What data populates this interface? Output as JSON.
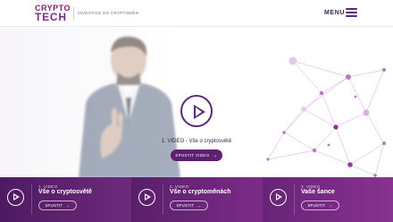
{
  "header": {
    "logo_top": "CRYPTO",
    "logo_bottom": "TECH",
    "tagline": "INVESTICE DO CRYPTOMĚN",
    "menu_label": "MENU",
    "menu_icon": "hamburger-icon"
  },
  "hero": {
    "video_title": "1. VIDEO - Vše o cryptosvětě",
    "start_button_label": "SPUSTIT VIDEO",
    "arrow_glyph": "→",
    "play_icon": "play-icon",
    "slide_count": 3,
    "active_slide": 1
  },
  "cards": [
    {
      "label": "1. VIDEO",
      "title": "Vše o cryptosvětě",
      "button_label": "SPUSTIT",
      "arrow_glyph": "→"
    },
    {
      "label": "2. VIDEO",
      "title": "Vše o cryptoměnách",
      "button_label": "SPUSTIT",
      "arrow_glyph": "→"
    },
    {
      "label": "3. VIDEO",
      "title": "Vaše šance",
      "button_label": "SPUSTIT",
      "arrow_glyph": "→"
    }
  ],
  "colors": {
    "brand_purple": "#5a2a78",
    "brand_magenta": "#8a1c7c",
    "card_gradient_start": "#4e1a61",
    "card_gradient_end": "#87328f"
  }
}
